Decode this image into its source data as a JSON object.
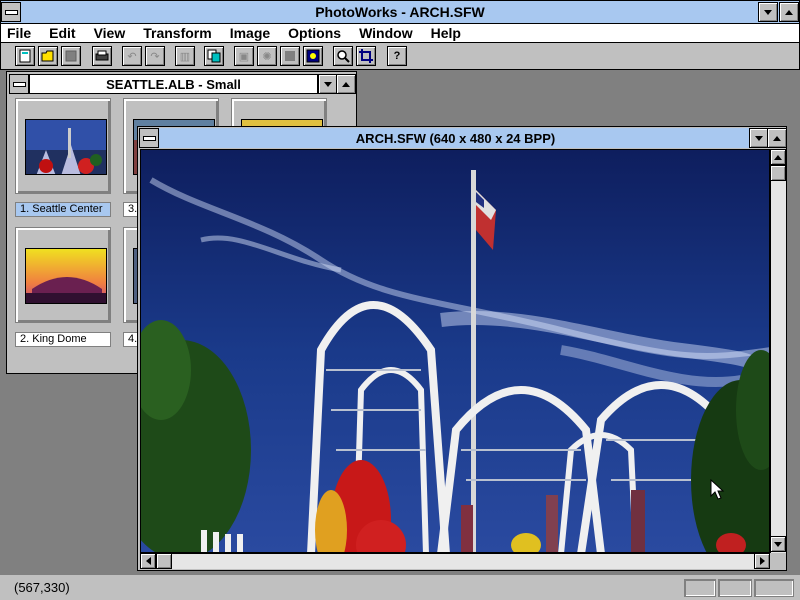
{
  "app": {
    "title": "PhotoWorks - ARCH.SFW"
  },
  "menu": [
    "File",
    "Edit",
    "View",
    "Transform",
    "Image",
    "Options",
    "Window",
    "Help"
  ],
  "toolbar": {
    "buttons": [
      {
        "name": "new-icon",
        "glyph": "▫"
      },
      {
        "name": "open-folder-icon",
        "glyph": "📂"
      },
      {
        "name": "save-icon",
        "glyph": "▪"
      },
      {
        "name": "print-icon",
        "glyph": "▤"
      },
      {
        "name": "undo-icon",
        "glyph": "↶"
      },
      {
        "name": "redo-icon",
        "glyph": "↷"
      },
      {
        "name": "histogram-icon",
        "glyph": "▥"
      },
      {
        "name": "copy-icon",
        "glyph": "⧉"
      },
      {
        "name": "frame-icon",
        "glyph": "▣"
      },
      {
        "name": "effects-icon",
        "glyph": "✺"
      },
      {
        "name": "gray-block-icon",
        "glyph": "■"
      },
      {
        "name": "color-picture-icon",
        "glyph": "◙"
      },
      {
        "name": "zoom-icon",
        "glyph": "🔍"
      },
      {
        "name": "crop-icon",
        "glyph": "⌗"
      },
      {
        "name": "help-icon",
        "glyph": "?"
      }
    ]
  },
  "album": {
    "title": "SEATTLE.ALB - Small",
    "items": [
      {
        "label": "1. Seattle Center"
      },
      {
        "label": "3."
      },
      {
        "label": ""
      },
      {
        "label": "2. King Dome"
      },
      {
        "label": "4."
      }
    ]
  },
  "image_window": {
    "title": "ARCH.SFW (640 x 480 x 24 BPP)"
  },
  "status": {
    "coords": "(567,330)"
  },
  "colors": {
    "title_bar": "#a8c8f0",
    "selected_label": "#a8c8f0",
    "sky": "#1a3a8a"
  }
}
